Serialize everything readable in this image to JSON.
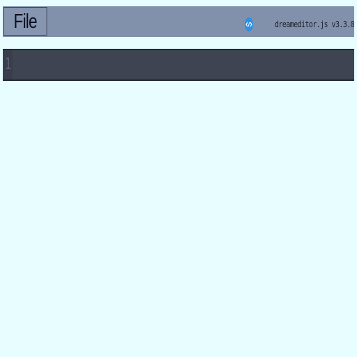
{
  "toolbar": {
    "file_label": "File",
    "brand_text": "dreameditor.js v3.3.0",
    "brand_icon": "code-icon"
  },
  "editor": {
    "line_numbers": [
      "1"
    ],
    "content": ""
  },
  "colors": {
    "page_background": "#e8fdff",
    "toolbar": "#8291ab",
    "editor_background": "#3f4453",
    "brand_icon": "#2f8fe0"
  }
}
